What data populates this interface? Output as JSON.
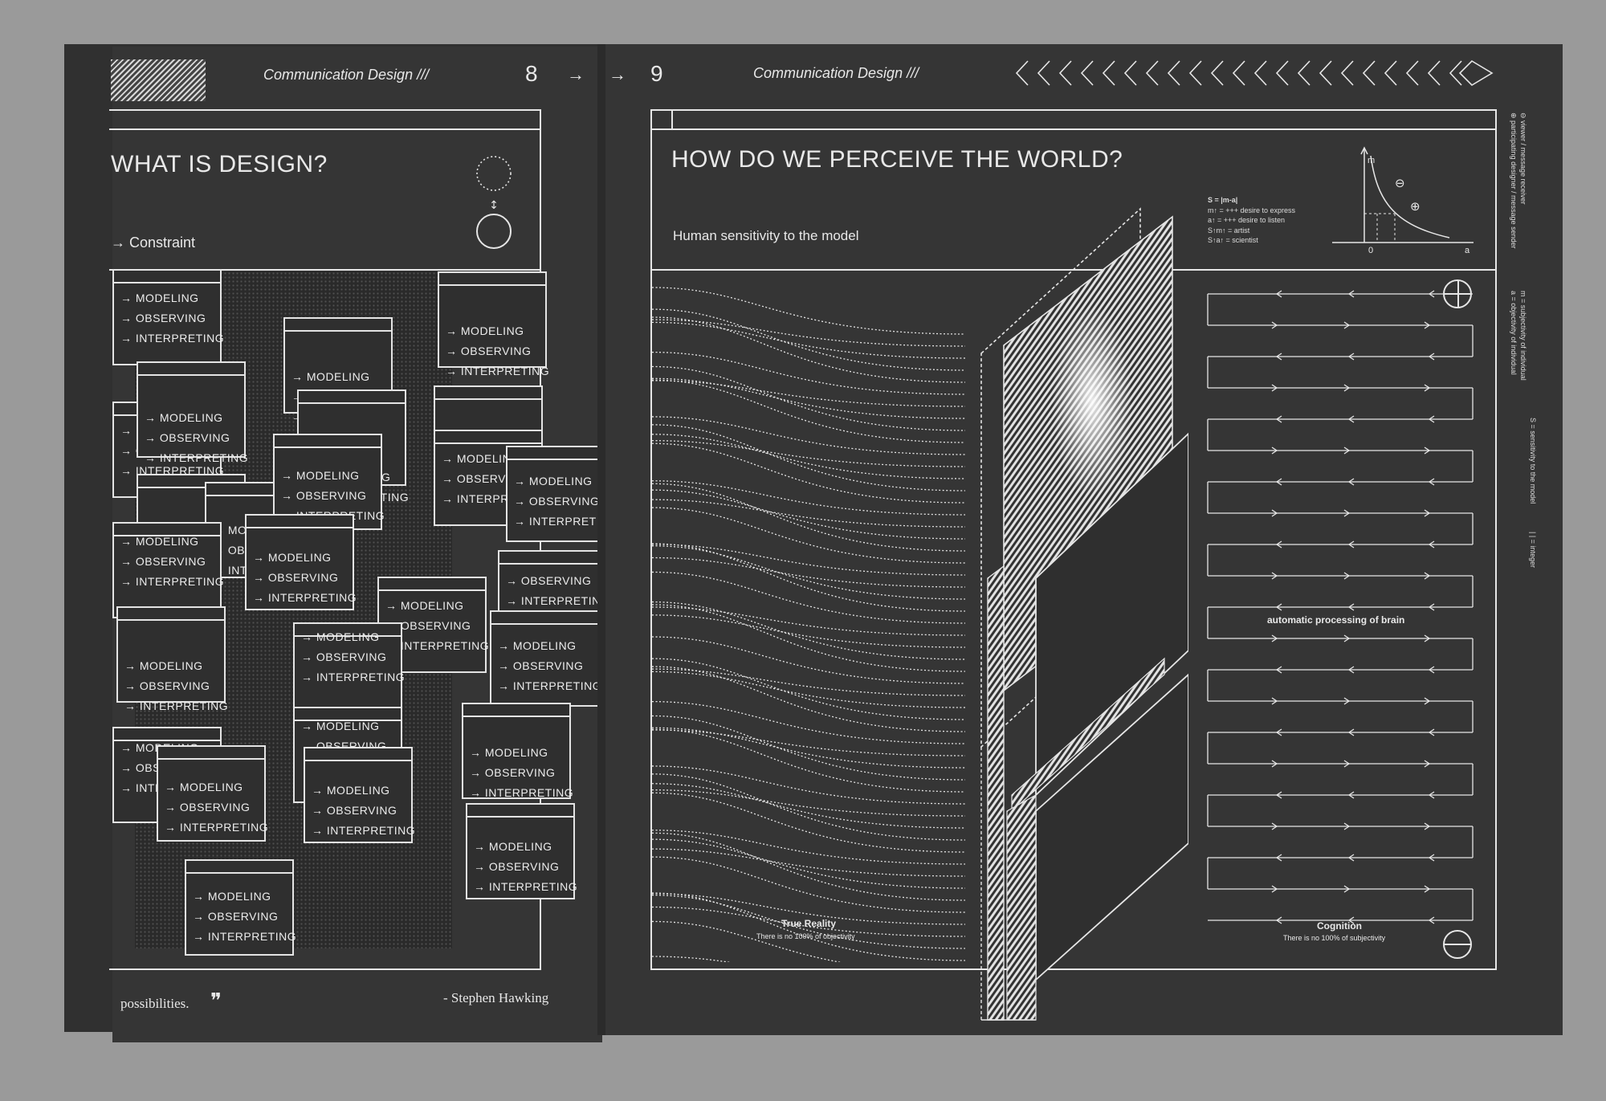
{
  "left_page": {
    "section_label": "Communication Design ///",
    "page_number": "8",
    "arrow": "→",
    "title": "WHAT IS DESIGN?",
    "subtitle": "→ Constraint",
    "card_lines": [
      "→ MODELING",
      "→ OBSERVING",
      "→ INTERPRETING"
    ],
    "quote_end": "possibilities.",
    "quote_mark": "❞",
    "quote_author": "- Stephen Hawking"
  },
  "right_page": {
    "arrow": "→",
    "page_number": "9",
    "section_label": "Communication Design ///",
    "title": "HOW DO WE PERCEIVE THE WORLD?",
    "subtitle": "Human sensitivity to the model",
    "formula": {
      "line1": "S = |m-a|",
      "line2": "m↑ = +++ desire to express",
      "line3": "a↑ = +++ desire to listen",
      "line4": "S↑m↑ = artist",
      "line5": "S↑a↑ = scientist"
    },
    "graph": {
      "axis_y": "m",
      "axis_x": "a",
      "origin": "0",
      "minus_symbol": "⊖",
      "plus_symbol": "⊕"
    },
    "true_reality": {
      "title": "True Reality",
      "caption": "There is no 100% of objectivity"
    },
    "automatic_processing": "automatic processing of brain",
    "cognition": {
      "title": "Cognition",
      "caption": "There is no 100% of subjectivity"
    },
    "side_legend": [
      "⊖ viewer / message receiver",
      "⊕ participating designer / message sender",
      "m = subjectivity of individual",
      "a = objectivity of individual",
      "S = sensitivity to the model",
      "| | = integer"
    ]
  },
  "colors": {
    "page": "#333333",
    "ink": "#e6e6e6",
    "background": "#9a9a9a"
  }
}
